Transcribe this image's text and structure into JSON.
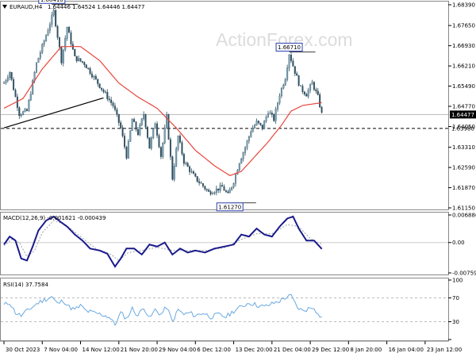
{
  "chart_data": [
    {
      "type": "candlestick",
      "header": {
        "symbol": "EURAUD,H4",
        "ohlc": "1.64446 1.64524 1.64446 1.64477"
      },
      "watermark": "ActionForex.com",
      "ylim": [
        1.6115,
        1.6839
      ],
      "y_ticks": [
        "1.68390",
        "1.67650",
        "1.66930",
        "1.66210",
        "1.65490",
        "1.64770",
        "1.64050",
        "1.63310",
        "1.62590",
        "1.61870",
        "1.61150"
      ],
      "current_price": "1.64477",
      "support_level": "1.63980",
      "annotations": [
        {
          "text": "1.68410",
          "index": 25,
          "value": 1.6841
        },
        {
          "text": "1.66710",
          "index": 149,
          "value": 1.6671
        },
        {
          "text": "1.61270",
          "index": 118,
          "value": 1.6127
        }
      ],
      "trendline": {
        "from": [
          0,
          1.64
        ],
        "to": [
          52,
          1.6507
        ]
      },
      "close_anchors": [
        [
          0,
          1.656
        ],
        [
          3,
          1.66
        ],
        [
          8,
          1.645
        ],
        [
          12,
          1.646
        ],
        [
          17,
          1.663
        ],
        [
          22,
          1.673
        ],
        [
          26,
          1.6815
        ],
        [
          30,
          1.664
        ],
        [
          33,
          1.676
        ],
        [
          37,
          1.665
        ],
        [
          42,
          1.663
        ],
        [
          47,
          1.658
        ],
        [
          52,
          1.653
        ],
        [
          57,
          1.648
        ],
        [
          61,
          1.64
        ],
        [
          64,
          1.63
        ],
        [
          67,
          1.643
        ],
        [
          70,
          1.638
        ],
        [
          73,
          1.645
        ],
        [
          76,
          1.633
        ],
        [
          79,
          1.642
        ],
        [
          82,
          1.63
        ],
        [
          85,
          1.644
        ],
        [
          88,
          1.622
        ],
        [
          91,
          1.637
        ],
        [
          94,
          1.628
        ],
        [
          97,
          1.625
        ],
        [
          100,
          1.622
        ],
        [
          103,
          1.62
        ],
        [
          107,
          1.617
        ],
        [
          111,
          1.618
        ],
        [
          114,
          1.619
        ],
        [
          117,
          1.616
        ],
        [
          120,
          1.621
        ],
        [
          123,
          1.628
        ],
        [
          126,
          1.633
        ],
        [
          129,
          1.639
        ],
        [
          132,
          1.642
        ],
        [
          135,
          1.64
        ],
        [
          138,
          1.646
        ],
        [
          141,
          1.643
        ],
        [
          144,
          1.652
        ],
        [
          147,
          1.658
        ],
        [
          149,
          1.6665
        ],
        [
          152,
          1.66
        ],
        [
          155,
          1.654
        ],
        [
          158,
          1.652
        ],
        [
          161,
          1.656
        ],
        [
          164,
          1.651
        ],
        [
          166,
          1.645
        ]
      ],
      "ma_anchors": [
        [
          0,
          1.647
        ],
        [
          10,
          1.6505
        ],
        [
          20,
          1.661
        ],
        [
          30,
          1.669
        ],
        [
          40,
          1.669
        ],
        [
          50,
          1.664
        ],
        [
          60,
          1.656
        ],
        [
          70,
          1.651
        ],
        [
          80,
          1.647
        ],
        [
          90,
          1.64
        ],
        [
          100,
          1.632
        ],
        [
          110,
          1.6265
        ],
        [
          118,
          1.623
        ],
        [
          124,
          1.6245
        ],
        [
          130,
          1.629
        ],
        [
          138,
          1.635
        ],
        [
          145,
          1.641
        ],
        [
          150,
          1.646
        ],
        [
          156,
          1.648
        ],
        [
          166,
          1.649
        ]
      ],
      "x_ticks": [
        {
          "label": "30 Oct 2023",
          "index": 0
        },
        {
          "label": "7 Nov 04:00",
          "index": 20
        },
        {
          "label": "14 Nov 12:00",
          "index": 40
        },
        {
          "label": "21 Nov 20:00",
          "index": 60
        },
        {
          "label": "29 Nov 04:00",
          "index": 80
        },
        {
          "label": "6 Dec 12:00",
          "index": 100
        },
        {
          "label": "13 Dec 20:00",
          "index": 120
        },
        {
          "label": "21 Dec 04:00",
          "index": 140
        },
        {
          "label": "29 Dec 12:00",
          "index": 160
        },
        {
          "label": "8 Jan 20:00",
          "index": 180
        },
        {
          "label": "16 Jan 04:00",
          "index": 200
        },
        {
          "label": "23 Jan 12:00",
          "index": 220
        }
      ]
    },
    {
      "type": "line",
      "title": "MACD(12,26,9) -0.001621 -0.000439",
      "ylim": [
        -0.007591,
        0.006886
      ],
      "y_ticks": [
        "0.006886",
        "0.00",
        "-0.007591"
      ],
      "macd_anchors": [
        [
          0,
          -0.0005
        ],
        [
          3,
          0.0015
        ],
        [
          6,
          0.0005
        ],
        [
          9,
          -0.004
        ],
        [
          12,
          -0.0045
        ],
        [
          15,
          -0.001
        ],
        [
          18,
          0.003
        ],
        [
          22,
          0.0055
        ],
        [
          26,
          0.0065
        ],
        [
          30,
          0.005
        ],
        [
          33,
          0.004
        ],
        [
          37,
          0.002
        ],
        [
          41,
          0.0005
        ],
        [
          45,
          -0.0015
        ],
        [
          50,
          -0.002
        ],
        [
          54,
          -0.0028
        ],
        [
          58,
          -0.006
        ],
        [
          61,
          -0.004
        ],
        [
          64,
          -0.0015
        ],
        [
          68,
          -0.0015
        ],
        [
          72,
          -0.003
        ],
        [
          76,
          -0.0005
        ],
        [
          80,
          -0.001
        ],
        [
          84,
          0.0
        ],
        [
          88,
          -0.003
        ],
        [
          92,
          -0.0015
        ],
        [
          96,
          -0.0025
        ],
        [
          100,
          -0.002
        ],
        [
          105,
          -0.0025
        ],
        [
          110,
          -0.0015
        ],
        [
          115,
          -0.001
        ],
        [
          120,
          -0.0005
        ],
        [
          124,
          0.002
        ],
        [
          128,
          0.0015
        ],
        [
          132,
          0.0035
        ],
        [
          136,
          0.002
        ],
        [
          140,
          0.0015
        ],
        [
          144,
          0.004
        ],
        [
          148,
          0.006
        ],
        [
          151,
          0.0065
        ],
        [
          154,
          0.0035
        ],
        [
          158,
          0.0005
        ],
        [
          162,
          0.0005
        ],
        [
          166,
          -0.0016
        ]
      ],
      "signal_anchors": [
        [
          0,
          -0.0008
        ],
        [
          4,
          0.0008
        ],
        [
          8,
          0.0
        ],
        [
          12,
          -0.0035
        ],
        [
          16,
          -0.002
        ],
        [
          20,
          0.0025
        ],
        [
          26,
          0.0055
        ],
        [
          32,
          0.0045
        ],
        [
          40,
          0.0015
        ],
        [
          48,
          -0.0015
        ],
        [
          56,
          -0.003
        ],
        [
          60,
          -0.0045
        ],
        [
          65,
          -0.0025
        ],
        [
          72,
          -0.002
        ],
        [
          80,
          -0.0012
        ],
        [
          88,
          -0.002
        ],
        [
          96,
          -0.002
        ],
        [
          106,
          -0.002
        ],
        [
          116,
          -0.0012
        ],
        [
          124,
          0.0008
        ],
        [
          132,
          0.0022
        ],
        [
          140,
          0.0022
        ],
        [
          148,
          0.0045
        ],
        [
          154,
          0.004
        ],
        [
          160,
          0.001
        ],
        [
          166,
          -0.0004
        ]
      ]
    },
    {
      "type": "line",
      "title": "RSI(14) 37.7584",
      "ylim": [
        0,
        100
      ],
      "y_ticks": [
        "100",
        "70",
        "30",
        "0"
      ],
      "guide_levels": [
        70,
        30
      ],
      "rsi_anchors": [
        [
          0,
          58
        ],
        [
          3,
          62
        ],
        [
          6,
          45
        ],
        [
          9,
          40
        ],
        [
          12,
          48
        ],
        [
          15,
          55
        ],
        [
          18,
          62
        ],
        [
          22,
          68
        ],
        [
          25,
          72
        ],
        [
          28,
          60
        ],
        [
          31,
          66
        ],
        [
          34,
          55
        ],
        [
          37,
          50
        ],
        [
          40,
          57
        ],
        [
          43,
          48
        ],
        [
          47,
          45
        ],
        [
          51,
          42
        ],
        [
          55,
          38
        ],
        [
          58,
          25
        ],
        [
          61,
          45
        ],
        [
          64,
          35
        ],
        [
          67,
          52
        ],
        [
          70,
          40
        ],
        [
          73,
          55
        ],
        [
          76,
          35
        ],
        [
          79,
          50
        ],
        [
          82,
          42
        ],
        [
          85,
          55
        ],
        [
          88,
          30
        ],
        [
          91,
          50
        ],
        [
          94,
          42
        ],
        [
          97,
          45
        ],
        [
          100,
          40
        ],
        [
          104,
          45
        ],
        [
          108,
          38
        ],
        [
          112,
          42
        ],
        [
          116,
          38
        ],
        [
          120,
          48
        ],
        [
          124,
          55
        ],
        [
          128,
          62
        ],
        [
          132,
          58
        ],
        [
          136,
          55
        ],
        [
          140,
          60
        ],
        [
          144,
          65
        ],
        [
          148,
          72
        ],
        [
          150,
          73
        ],
        [
          153,
          55
        ],
        [
          156,
          48
        ],
        [
          159,
          52
        ],
        [
          162,
          55
        ],
        [
          164,
          42
        ],
        [
          166,
          38
        ]
      ]
    }
  ]
}
